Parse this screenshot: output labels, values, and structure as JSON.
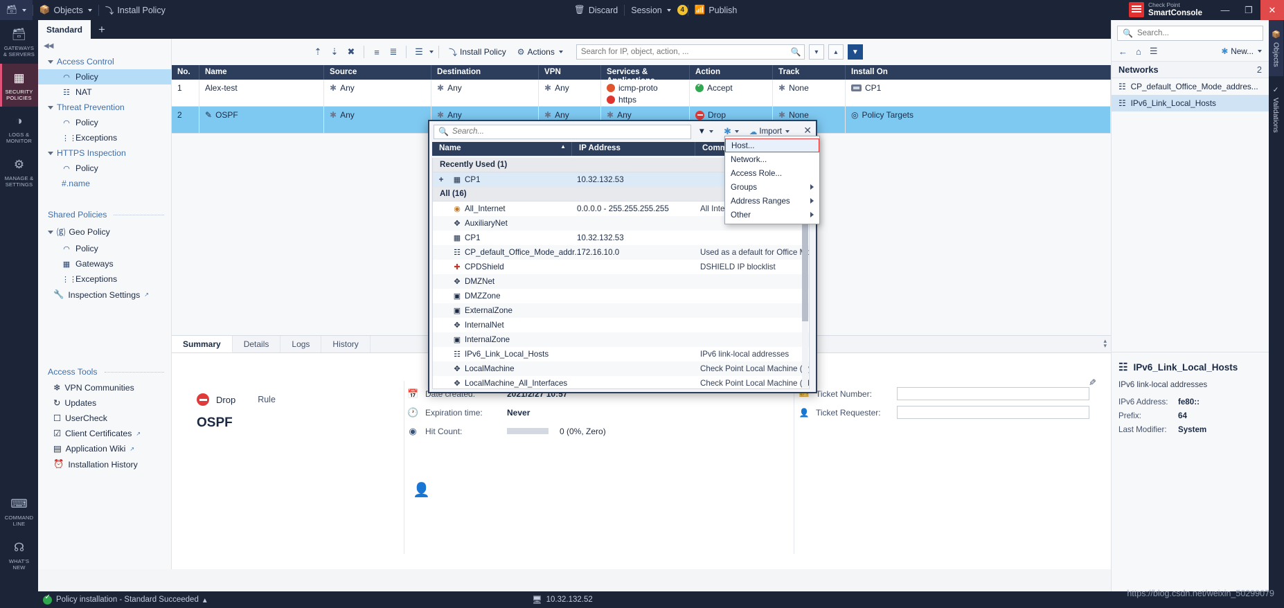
{
  "topbar": {
    "objects_label": "Objects",
    "install_policy_label": "Install Policy",
    "discard_label": "Discard",
    "session_label": "Session",
    "session_badge": "4",
    "publish_label": "Publish",
    "brand_line1": "Check Point",
    "brand_line2": "SmartConsole",
    "min_label": "—",
    "max_label": "❐",
    "close_label": "✕"
  },
  "tabs": {
    "policy_tab": "Standard",
    "add_tab": "+"
  },
  "rail": {
    "items": [
      {
        "icon": "servers-icon",
        "label": "GATEWAYS\n& SERVERS",
        "active": false
      },
      {
        "icon": "policies-icon",
        "label": "SECURITY\nPOLICIES",
        "active": true
      },
      {
        "icon": "gauge-icon",
        "label": "LOGS &\nMONITOR",
        "active": false
      },
      {
        "icon": "gear-icon",
        "label": "MANAGE &\nSETTINGS",
        "active": false
      }
    ],
    "bottom": [
      {
        "icon": "terminal-icon",
        "label": "COMMAND\nLINE"
      },
      {
        "icon": "question-icon",
        "label": "WHAT'S\nNEW"
      }
    ]
  },
  "nav": {
    "collapse": "◀◀",
    "groups": [
      {
        "label": "Access Control",
        "items": [
          {
            "label": "Policy",
            "icon": "policy-icon",
            "selected": true
          },
          {
            "label": "NAT",
            "icon": "nat-icon",
            "selected": false
          }
        ]
      },
      {
        "label": "Threat Prevention",
        "items": [
          {
            "label": "Policy",
            "icon": "policy-icon",
            "selected": false
          },
          {
            "label": "Exceptions",
            "icon": "exceptions-icon",
            "selected": false
          }
        ]
      },
      {
        "label": "HTTPS Inspection",
        "items": [
          {
            "label": "Policy",
            "icon": "policy-icon",
            "selected": false
          }
        ]
      }
    ],
    "name_placeholder": "#.name",
    "shared_policies_label": "Shared Policies",
    "geo_policy_label": "Geo Policy",
    "geo_items": [
      {
        "label": "Policy",
        "icon": "policy-icon"
      },
      {
        "label": "Gateways",
        "icon": "gateway-icon"
      },
      {
        "label": "Exceptions",
        "icon": "exceptions-icon"
      }
    ],
    "inspection_settings_label": "Inspection Settings",
    "access_tools_label": "Access Tools",
    "access_tools": [
      {
        "label": "VPN Communities",
        "icon": "vpn-icon",
        "external": false
      },
      {
        "label": "Updates",
        "icon": "updates-icon",
        "external": false
      },
      {
        "label": "UserCheck",
        "icon": "usercheck-icon",
        "external": false
      },
      {
        "label": "Client Certificates",
        "icon": "certificate-icon",
        "external": true
      },
      {
        "label": "Application Wiki",
        "icon": "wiki-icon",
        "external": true
      },
      {
        "label": "Installation History",
        "icon": "history-icon",
        "external": false
      }
    ]
  },
  "rule_toolbar": {
    "install_policy_label": "Install Policy",
    "actions_label": "Actions",
    "search_placeholder": "Search for IP, object, action, ...",
    "icons": [
      "add-rule-above-icon",
      "add-rule-below-icon",
      "delete-rule-icon",
      "add-section-icon",
      "merge-icon",
      "list-icon"
    ]
  },
  "rules": {
    "columns": [
      "No.",
      "Name",
      "Source",
      "Destination",
      "VPN",
      "Services & Applications",
      "Action",
      "Track",
      "Install On"
    ],
    "rows": [
      {
        "no": "1",
        "name": "Alex-test",
        "source": "Any",
        "destination": "Any",
        "vpn": "Any",
        "services": [
          "icmp-proto",
          "https"
        ],
        "action": "Accept",
        "track": "None",
        "install_on": "CP1",
        "selected": false
      },
      {
        "no": "2",
        "name": "OSPF",
        "source": "Any",
        "destination": "Any",
        "vpn": "Any",
        "services": [
          "Any"
        ],
        "action": "Drop",
        "track": "None",
        "install_on": "Policy Targets",
        "selected": true
      }
    ]
  },
  "detail": {
    "tabs": [
      "Summary",
      "Details",
      "Logs",
      "History"
    ],
    "active_tab": "Summary",
    "action": "Drop",
    "rule_label": "Rule",
    "rule_name": "OSPF",
    "meta": [
      {
        "icon": "calendar-icon",
        "key": "Date created:",
        "value": "2021/2/27 10:57"
      },
      {
        "icon": "clock-icon",
        "key": "Expiration time:",
        "value": "Never"
      },
      {
        "icon": "target-icon",
        "key": "Hit Count:",
        "value": "0 (0%, Zero)"
      }
    ],
    "fields": [
      {
        "icon": "ticket-icon",
        "key": "Ticket Number:",
        "value": ""
      },
      {
        "icon": "person-icon",
        "key": "Ticket Requester:",
        "value": ""
      }
    ]
  },
  "dialog": {
    "search_placeholder": "Search...",
    "filter_label": "filter-icon",
    "star_label": "new-object-icon",
    "import_label": "Import",
    "close_label": "✕",
    "columns": [
      "Name",
      "IP Address",
      "Comments"
    ],
    "sort_arrow": "▲",
    "groups": [
      {
        "label": "Recently Used (1)",
        "rows": [
          {
            "plus": "+",
            "icon": "gateway-icon",
            "name": "CP1",
            "ip": "10.32.132.53",
            "comment": "",
            "highlight": true
          }
        ]
      },
      {
        "label": "All (16)",
        "rows": [
          {
            "plus": "",
            "icon": "internet-icon",
            "name": "All_Internet",
            "ip": "0.0.0.0 - 255.255.255.255",
            "comment": "All Internet A"
          },
          {
            "plus": "",
            "icon": "network-icon",
            "name": "AuxiliaryNet",
            "ip": "",
            "comment": ""
          },
          {
            "plus": "",
            "icon": "gateway-icon",
            "name": "CP1",
            "ip": "10.32.132.53",
            "comment": ""
          },
          {
            "plus": "",
            "icon": "range-icon",
            "name": "CP_default_Office_Mode_addr...",
            "ip": "172.16.10.0",
            "comment": "Used as a default for Office Mode. I..."
          },
          {
            "plus": "",
            "icon": "shield-icon",
            "name": "CPDShield",
            "ip": "",
            "comment": "DSHIELD IP blocklist"
          },
          {
            "plus": "",
            "icon": "network-icon",
            "name": "DMZNet",
            "ip": "",
            "comment": ""
          },
          {
            "plus": "",
            "icon": "zone-icon",
            "name": "DMZZone",
            "ip": "",
            "comment": ""
          },
          {
            "plus": "",
            "icon": "zone-icon",
            "name": "ExternalZone",
            "ip": "",
            "comment": ""
          },
          {
            "plus": "",
            "icon": "network-icon",
            "name": "InternalNet",
            "ip": "",
            "comment": ""
          },
          {
            "plus": "",
            "icon": "zone-icon",
            "name": "InternalZone",
            "ip": "",
            "comment": ""
          },
          {
            "plus": "",
            "icon": "range-icon",
            "name": "IPv6_Link_Local_Hosts",
            "ip": "",
            "comment": "IPv6 link-local addresses"
          },
          {
            "plus": "",
            "icon": "network-icon",
            "name": "LocalMachine",
            "ip": "",
            "comment": "Check Point Local Machine (Dynami..."
          },
          {
            "plus": "",
            "icon": "network-icon",
            "name": "LocalMachine_All_Interfaces",
            "ip": "",
            "comment": "Check Point Local Machine (All Inter..."
          }
        ]
      }
    ]
  },
  "context_menu": {
    "items": [
      {
        "label": "Host...",
        "submenu": false,
        "selected": true
      },
      {
        "label": "Network...",
        "submenu": false,
        "selected": false
      },
      {
        "label": "Access Role...",
        "submenu": false,
        "selected": false
      },
      {
        "label": "Groups",
        "submenu": true,
        "selected": false
      },
      {
        "label": "Address Ranges",
        "submenu": true,
        "selected": false
      },
      {
        "label": "Other",
        "submenu": true,
        "selected": false
      }
    ]
  },
  "right_panel": {
    "search_placeholder": "Search...",
    "new_label": "New...",
    "tools": [
      "back-icon",
      "home-icon",
      "list-view-icon"
    ],
    "section_title": "Networks",
    "section_count": "2",
    "items": [
      {
        "icon": "range-icon",
        "label": "CP_default_Office_Mode_addres...",
        "selected": false
      },
      {
        "icon": "range-icon",
        "label": "IPv6_Link_Local_Hosts",
        "selected": true
      }
    ],
    "detail": {
      "title": "IPv6_Link_Local_Hosts",
      "subtitle": "IPv6 link-local addresses",
      "rows": [
        {
          "key": "IPv6 Address:",
          "value": "fe80::"
        },
        {
          "key": "Prefix:",
          "value": "64"
        },
        {
          "key": "Last Modifier:",
          "value": "System"
        }
      ]
    }
  },
  "vrail": {
    "tabs": [
      "Objects",
      "Validations"
    ]
  },
  "status": {
    "message": "Policy installation - Standard Succeeded",
    "caret": "▴",
    "server": "10.32.132.52",
    "watermark": "https://blog.csdn.net/weixin_50299079"
  }
}
